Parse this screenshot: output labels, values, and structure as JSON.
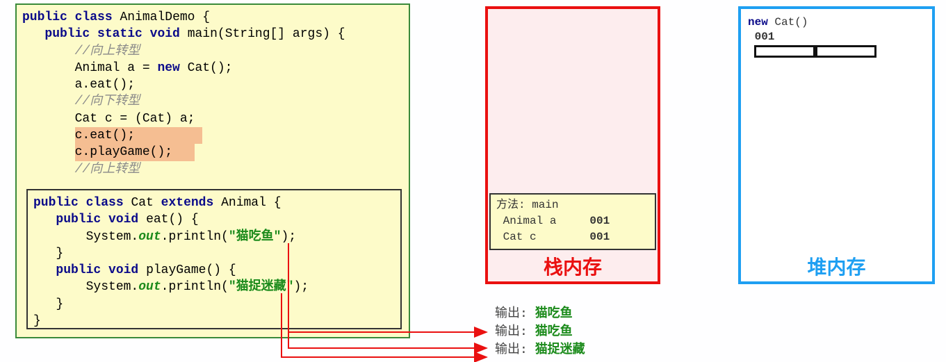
{
  "code": {
    "class_decl": "AnimalDemo {",
    "main_sig": "main(String[] args) {",
    "cm_up1": "//向上转型",
    "line_new": "       Animal a = ",
    "line_new2": " Cat();",
    "line_eat": "       a.eat();",
    "cm_down": "//向下转型",
    "line_cast": "       Cat c = (Cat) a;",
    "line_ceat": "c.eat();",
    "line_play": "c.playGame();",
    "cm_up2": "//向上转型"
  },
  "inner": {
    "class_decl": "Cat ",
    "extends": "extends",
    "super": " Animal {",
    "eat_sig": "eat() {",
    "println1_pre": "       System.",
    "println1_post": ".println(",
    "str1": "\"猫吃鱼\"",
    "play_sig": "playGame() {",
    "str2": "\"猫捉迷藏\""
  },
  "stack": {
    "frame_title": "方法: main",
    "var1": " Animal a     ",
    "addr1": "001",
    "var2": " Cat c        ",
    "addr2": "001",
    "label": "栈内存"
  },
  "heap": {
    "new_kw": "new",
    "new_expr": " Cat()",
    "addr": " 001",
    "label": "堆内存"
  },
  "output": {
    "lbl": "输出: ",
    "o1": "猫吃鱼",
    "o2": "猫吃鱼",
    "o3": "猫捉迷藏"
  },
  "kw": {
    "public": "public",
    "class": "class",
    "static": "static",
    "void": "void",
    "new": "new"
  }
}
